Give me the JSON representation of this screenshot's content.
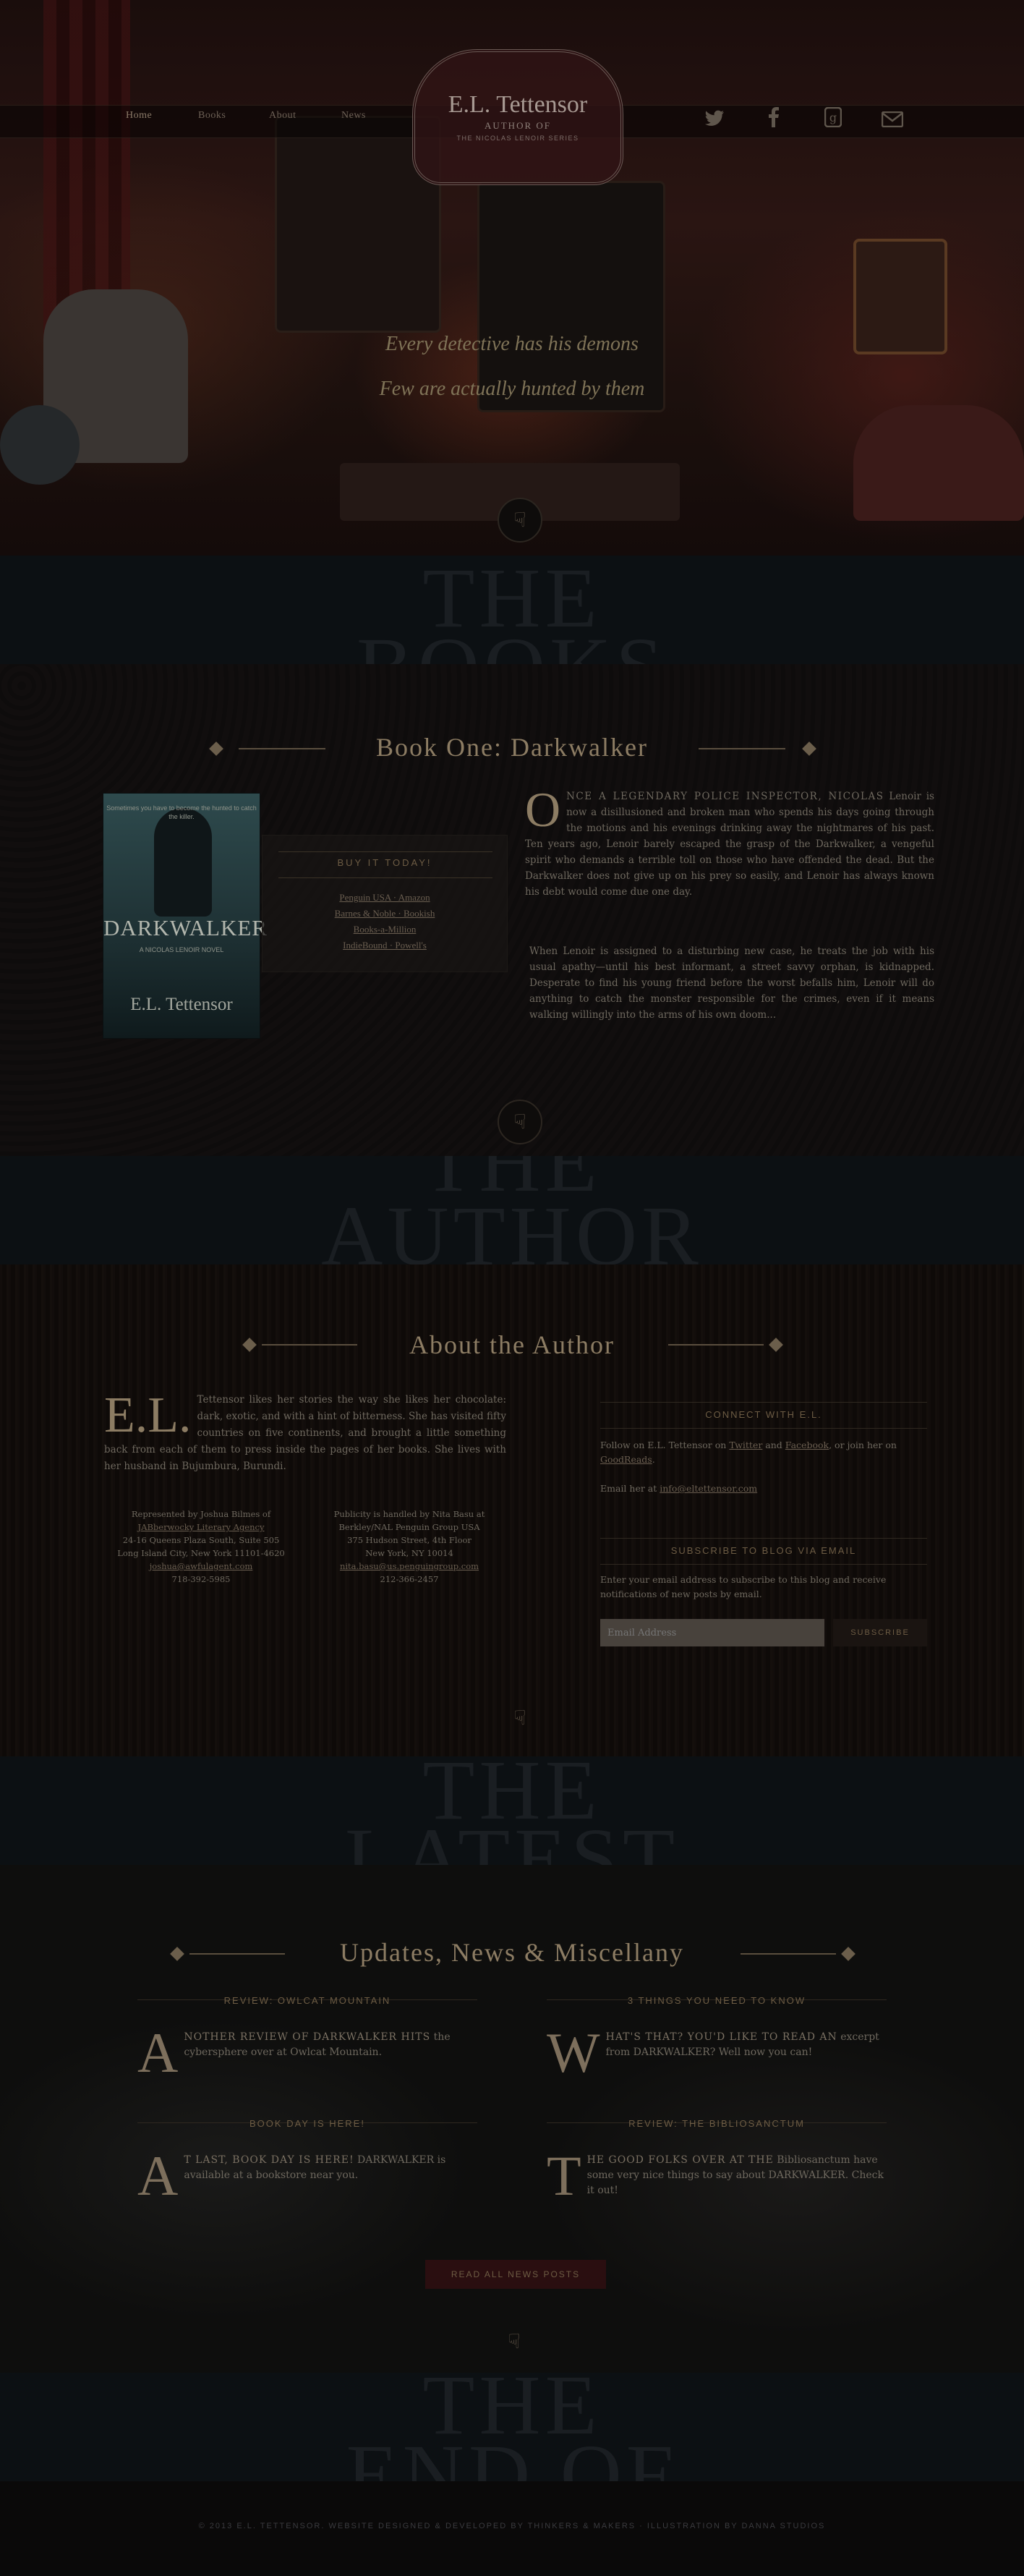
{
  "nav": {
    "items": [
      "Home",
      "Books",
      "About",
      "News"
    ]
  },
  "logo": {
    "title": "E.L. Tettensor",
    "subtitle": "AUTHOR OF",
    "series": "THE NICOLAS LENOIR SERIES"
  },
  "social_icons": [
    "twitter-icon",
    "facebook-icon",
    "goodreads-icon",
    "email-icon"
  ],
  "hero": {
    "tagline_1": "Every detective has his demons",
    "tagline_2": "Few are actually hunted by them"
  },
  "banners": {
    "books_1": "THE",
    "books_2": "BOOKS",
    "author_1": "THE",
    "author_2": "AUTHOR",
    "latest_1": "THE",
    "latest_2": "LATEST",
    "end_1": "THE",
    "end_2": "END OF"
  },
  "book": {
    "section_title": "Book One: Darkwalker",
    "cover": {
      "blurb": "Sometimes you have to become the hunted to catch the killer.",
      "title": "DARKWALKER",
      "author": "E.L. Tettensor",
      "subline": "A NICOLAS LENOIR NOVEL"
    },
    "buy_heading": "BUY IT TODAY!",
    "buy_links": [
      "Penguin USA · Amazon",
      "Barnes & Noble · Bookish",
      "Books-a-Million",
      "IndieBound · Powell's"
    ],
    "dropcap": "O",
    "para1_lead": "NCE A LEGENDARY POLICE INSPECTOR, NICOLAS",
    "para1": "Lenoir is now a disillusioned and broken man who spends his days going through the motions and his evenings drinking away the nightmares of his past. Ten years ago, Lenoir barely escaped the grasp of the Darkwalker, a vengeful spirit who demands a terrible toll on those who have offended the dead. But the Darkwalker does not give up on his prey so easily, and Lenoir has always known his debt would come due one day.",
    "para2": "When Lenoir is assigned to a disturbing new case, he treats the job with his usual apathy—until his best informant, a street savvy orphan, is kidnapped. Desperate to find his young friend before the worst befalls him, Lenoir will do anything to catch the monster responsible for the crimes, even if it means walking willingly into the arms of his own doom..."
  },
  "author": {
    "section_title": "About the Author",
    "dropcap": "E.L.",
    "bio": "Tettensor likes her stories the way she likes her chocolate: dark, exotic, and with a hint of bitterness. She has visited fifty countries on five continents, and brought a little something back from each of them to press inside the pages of her books. She lives with her husband in Bujumbura, Burundi.",
    "rep": [
      "Represented by Joshua Bilmes of",
      "JABberwocky Literary Agency",
      "24-16 Queens Plaza South, Suite 505",
      "Long Island City, New York 11101-4620",
      "joshua@awfulagent.com",
      "718-392-5985"
    ],
    "publicity": [
      "Publicity is handled by Nita Basu at",
      "Berkley/NAL Penguin Group USA",
      "375 Hudson Street, 4th Floor",
      "New York, NY 10014",
      "nita.basu@us.penguingroup.com",
      "212-366-2457"
    ],
    "connect_heading": "CONNECT WITH E.L.",
    "connect_text_a": "Follow on E.L. Tettensor on ",
    "twitter": "Twitter",
    "and": " and ",
    "facebook": "Facebook",
    "connect_text_b": ", or join her on ",
    "goodreads": "GoodReads",
    "email_text": "Email her at ",
    "email": "info@eltettensor.com",
    "subscribe_heading": "SUBSCRIBE TO BLOG VIA EMAIL",
    "subscribe_text": "Enter your email address to subscribe to this blog and receive notifications of new posts by email.",
    "email_placeholder": "Email Address",
    "subscribe_button": "SUBSCRIBE"
  },
  "news": {
    "section_title": "Updates, News & Miscellany",
    "posts": [
      {
        "heading": "REVIEW: OWLCAT MOUNTAIN",
        "cap": "A",
        "first": "NOTHER REVIEW OF DARKWALKER HITS",
        "body": "the cybersphere over at Owlcat Mountain."
      },
      {
        "heading": "3 THINGS YOU NEED TO KNOW",
        "cap": "W",
        "first": "HAT'S THAT? YOU'D LIKE TO READ AN",
        "body": "excerpt from DARKWALKER? Well now you can!"
      },
      {
        "heading": "BOOK DAY IS HERE!",
        "cap": "A",
        "first": "T LAST, BOOK DAY IS HERE!",
        "body": "DARKWALKER is available at a bookstore near you."
      },
      {
        "heading": "REVIEW: THE BIBLIOSANCTUM",
        "cap": "T",
        "first": "HE GOOD FOLKS OVER AT THE",
        "body": "Bibliosanctum have some very nice things to say about DARKWALKER. Check it out!"
      }
    ],
    "read_all": "READ ALL NEWS POSTS"
  },
  "footer": {
    "text": "© 2013 E.L. TETTENSOR. WEBSITE DESIGNED & DEVELOPED BY THINKERS & MAKERS · ILLUSTRATION BY DANNA STUDIOS"
  }
}
